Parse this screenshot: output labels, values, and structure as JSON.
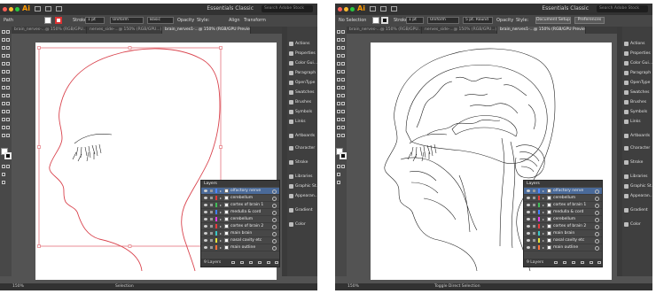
{
  "windows": [
    {
      "app_logo": "Ai",
      "workspace": "Essentials Classic",
      "search_placeholder": "Search Adobe Stock",
      "control_bar": {
        "selection": "Path",
        "stroke_label": "Stroke:",
        "stroke_weight": "1 pt",
        "profile": "Uniform",
        "brush": "Basic",
        "opacity_label": "Opacity",
        "style_label": "Style:",
        "align_label": "Align",
        "transform_label": "Transform"
      },
      "tabs": [
        "brain_nerves-...@ 150% (RGB/GPU...)",
        "nerves_side-...@ 150% (RGB/GPU...)",
        "brain_nerves1-...@ 150% (RGB/GPU Preview)"
      ],
      "active_tab": 2,
      "status": {
        "zoom": "150%",
        "tool": "Selection"
      }
    },
    {
      "app_logo": "Ai",
      "workspace": "Essentials Classic",
      "search_placeholder": "Search Adobe Stock",
      "control_bar": {
        "selection": "No Selection",
        "stroke_label": "Stroke:",
        "stroke_weight": "1 pt",
        "profile": "Uniform",
        "brush": "5 pt. Round",
        "opacity_label": "Opacity",
        "style_label": "Style:",
        "doc_setup": "Document Setup",
        "prefs": "Preferences"
      },
      "tabs": [
        "brain_nerves-...@ 150% (RGB/GPU...)",
        "nerves_side-...@ 150% (RGB/GPU...)",
        "brain_nerves1-...@ 150% (RGB/GPU Preview)"
      ],
      "active_tab": 2,
      "status": {
        "zoom": "150%",
        "tool": "Toggle Direct Selection"
      }
    }
  ],
  "dock_items": [
    "Actions",
    "Properties",
    "Color Gui...",
    "Paragraph",
    "OpenType",
    "Swatches",
    "Brushes",
    "Symbols",
    "Links",
    "Artboards",
    "Character",
    "Stroke",
    "Libraries",
    "Graphic St...",
    "Appearan...",
    "Gradient",
    "Color"
  ],
  "layers_panel": {
    "title": "Layers",
    "rows": [
      {
        "name": "olfactory nerve",
        "color": "#4f86ff"
      },
      {
        "name": "cerebellum",
        "color": "#e03a3a"
      },
      {
        "name": "cortex of brain 1",
        "color": "#3fbf57"
      },
      {
        "name": "medulla & cord",
        "color": "#3f7fff"
      },
      {
        "name": "cerebellum",
        "color": "#e63ae6"
      },
      {
        "name": "cortex of brain 2",
        "color": "#e83b3b"
      },
      {
        "name": "main brain",
        "color": "#3ac7c7"
      },
      {
        "name": "nasal cavity etc",
        "color": "#e5e53a"
      },
      {
        "name": "main outline",
        "color": "#ff6f3a"
      }
    ],
    "footer": "9 Layers"
  },
  "colors": {
    "app_bg": "#535353",
    "menubar": "#323232",
    "panel": "#474747",
    "selection_red": "#d9434d",
    "accent": "#4a6a99"
  }
}
